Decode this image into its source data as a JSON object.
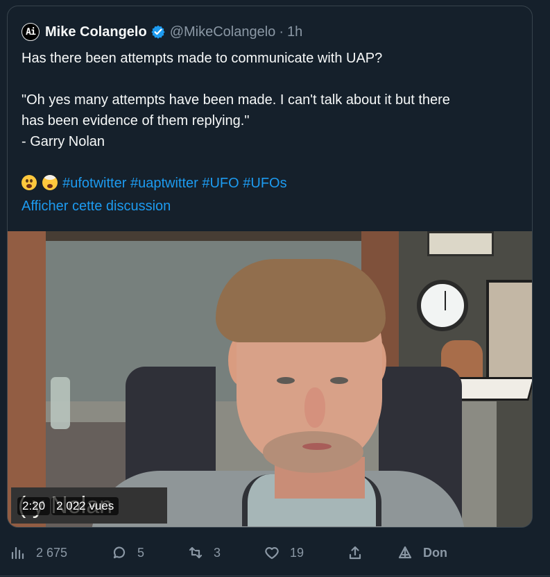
{
  "quoted_tweet": {
    "avatar_text": "Ai",
    "author_name": "Mike Colangelo",
    "handle": "@MikeColangelo",
    "separator": "·",
    "age": "1h",
    "text_lines": {
      "question": "Has there been attempts made to communicate with UAP?",
      "quote_line_1": "\"Oh yes many attempts have been made. I can't talk about it but there",
      "quote_line_2": "has been evidence of them replying.\"",
      "quote_line_3": "- Garry Nolan"
    },
    "emojis": [
      "astonished-face",
      "exploding-head"
    ],
    "hashtags": [
      "#ufotwitter",
      "#uaptwitter",
      "#UFO",
      "#UFOs"
    ],
    "link_text": "Afficher cette discussion"
  },
  "video": {
    "overlay_text": "(   y Nolan",
    "duration": "2:20",
    "views": "2 022 vues"
  },
  "action_bar": {
    "views": "2 675",
    "replies": "5",
    "retweets": "3",
    "likes": "19",
    "donate": "Don"
  },
  "colors": {
    "background": "#15202b",
    "accent": "#1d9bf0",
    "muted_text": "#8b98a5",
    "border": "#38444d"
  }
}
